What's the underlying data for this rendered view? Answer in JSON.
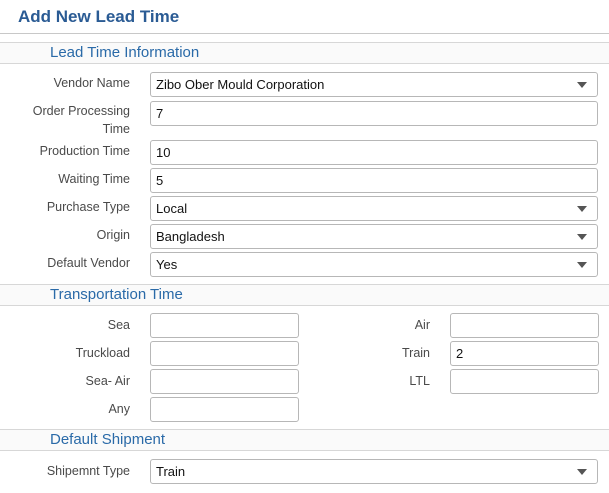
{
  "page": {
    "title": "Add New Lead Time"
  },
  "sections": {
    "lead_time_info": "Lead Time Information",
    "transportation": "Transportation Time",
    "default_shipment": "Default Shipment"
  },
  "lead_time": {
    "vendor_name": {
      "label": "Vendor Name",
      "value": "Zibo Ober Mould Corporation"
    },
    "order_processing": {
      "label_line1": "Order Processing",
      "label_line2": "Time",
      "value": "7"
    },
    "production_time": {
      "label": "Production Time",
      "value": "10"
    },
    "waiting_time": {
      "label": "Waiting Time",
      "value": "5"
    },
    "purchase_type": {
      "label": "Purchase Type",
      "value": "Local"
    },
    "origin": {
      "label": "Origin",
      "value": "Bangladesh"
    },
    "default_vendor": {
      "label": "Default Vendor",
      "value": "Yes"
    }
  },
  "transport": {
    "sea": {
      "label": "Sea",
      "value": ""
    },
    "air": {
      "label": "Air",
      "value": ""
    },
    "truckload": {
      "label": "Truckload",
      "value": ""
    },
    "train": {
      "label": "Train",
      "value": "2"
    },
    "sea_air": {
      "label": "Sea- Air",
      "value": ""
    },
    "ltl": {
      "label": "LTL",
      "value": ""
    },
    "any": {
      "label": "Any",
      "value": ""
    }
  },
  "shipment": {
    "shipment_type": {
      "label": "Shipemnt Type",
      "value": "Train"
    }
  },
  "icons": {
    "dropdown": "chevron-down-icon"
  }
}
